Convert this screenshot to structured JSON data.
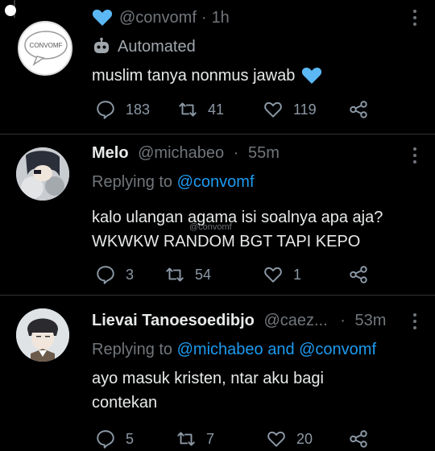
{
  "tweets": [
    {
      "handle": "@convomf",
      "dot": "·",
      "time": "1h",
      "automated_label": "Automated",
      "avatar_text": "CONVOMF",
      "text": "muslim tanya nonmus jawab",
      "actions": {
        "replies": "183",
        "retweets": "41",
        "likes": "119"
      }
    },
    {
      "name": "Melo",
      "handle": "@michabeo",
      "dot": "·",
      "time": "55m",
      "replying_prefix": "Replying to",
      "replying_to": "@convomf",
      "watermark": "@convomf",
      "text_line1": "kalo ulangan agama isi soalnya apa aja?",
      "text_line2": "WKWKW RANDOM BGT TAPI KEPO",
      "actions": {
        "replies": "3",
        "retweets": "54",
        "likes": "1"
      }
    },
    {
      "name": "Lievai Tanoesoedibjo",
      "handle": "@caez...",
      "dot": "·",
      "time": "53m",
      "replying_prefix": "Replying to",
      "replying_to": "@michabeo and @convomf",
      "text_line1": "ayo masuk kristen, ntar aku bagi",
      "text_line2": "contekan",
      "actions": {
        "replies": "5",
        "retweets": "7",
        "likes": "20"
      }
    }
  ],
  "colors": {
    "accent": "#1d9bf0",
    "heart_blue": "#5bb8f5",
    "background": "#000000",
    "muted": "#71767b"
  }
}
